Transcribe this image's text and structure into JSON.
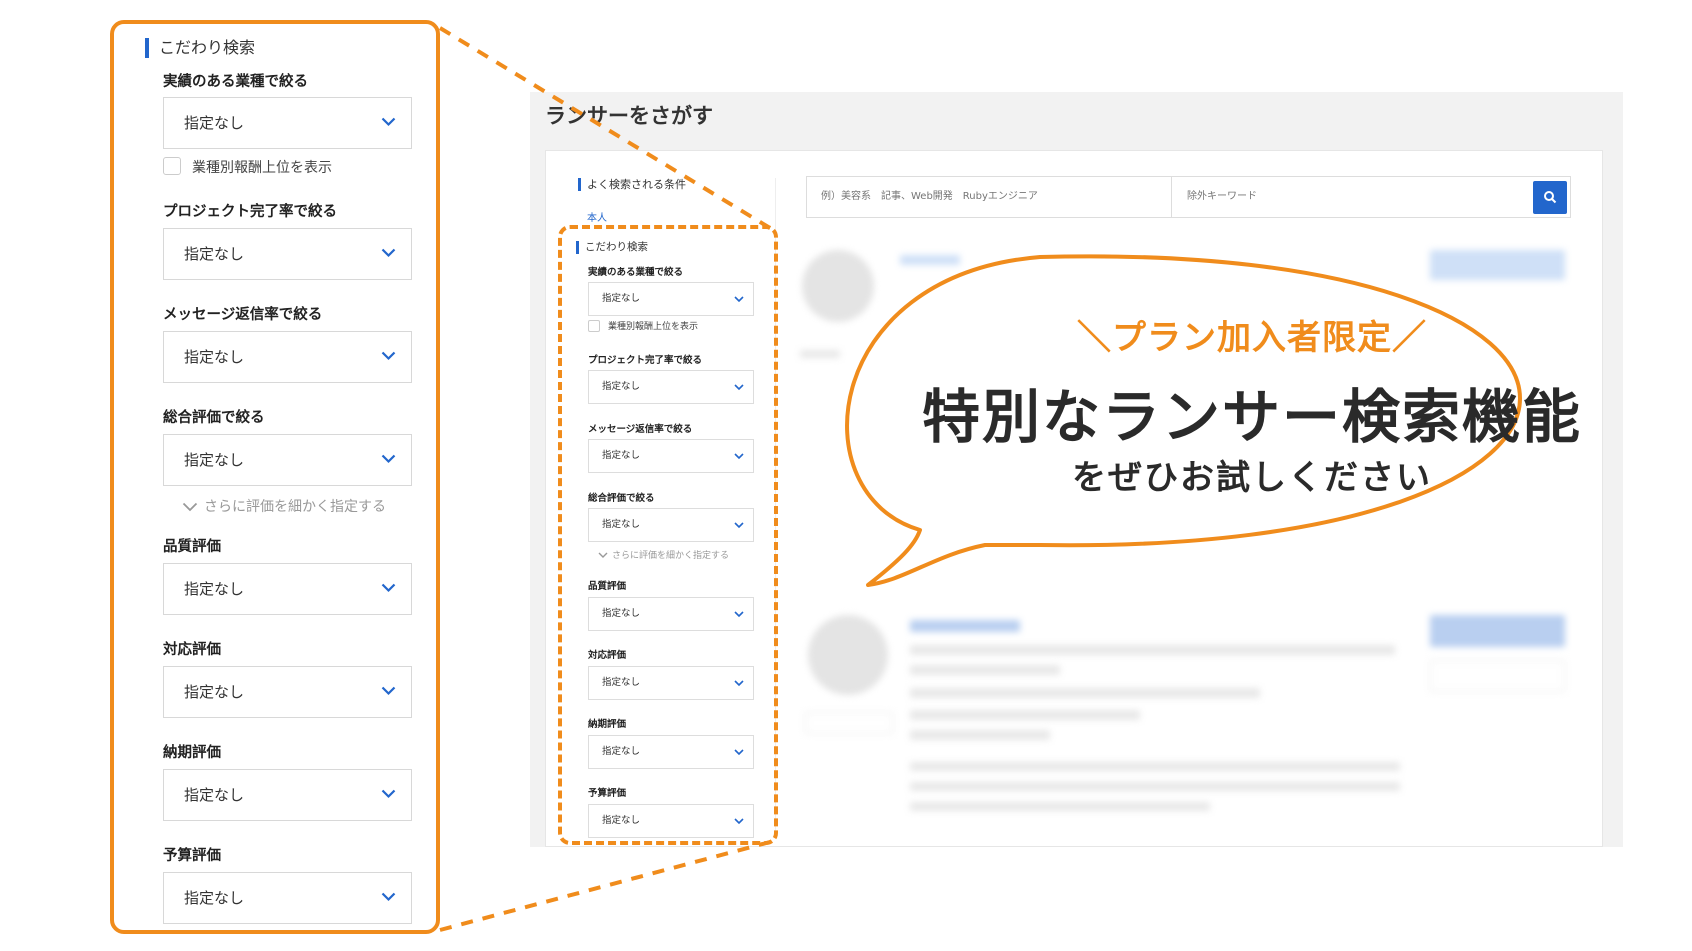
{
  "colors": {
    "accent": "#f08c1c",
    "brand_blue": "#2266cc",
    "text": "#2a2a2a"
  },
  "background_page": {
    "title": "ランサーをさがす",
    "sidebar_heading": "よく検索される条件",
    "sidebar_link": "本人",
    "search": {
      "keyword_placeholder": "例）美容系　記事、Web開発　Rubyエンジニア",
      "exclude_placeholder": "除外キーワード",
      "button_icon": "search-icon"
    }
  },
  "filters": {
    "heading": "こだわり検索",
    "default_option": "指定なし",
    "industry_label": "実績のある業種で絞る",
    "industry_value": "指定なし",
    "top_reward_checkbox": "業種別報酬上位を表示",
    "completion_label": "プロジェクト完了率で絞る",
    "completion_value": "指定なし",
    "reply_label": "メッセージ返信率で絞る",
    "reply_value": "指定なし",
    "overall_label": "総合評価で絞る",
    "overall_value": "指定なし",
    "more_ratings": "さらに評価を細かく指定する",
    "quality_label": "品質評価",
    "quality_value": "指定なし",
    "response_label": "対応評価",
    "response_value": "指定なし",
    "deadline_label": "納期評価",
    "deadline_value": "指定なし",
    "budget_label": "予算評価",
    "budget_value": "指定なし"
  },
  "promo": {
    "subtitle": "＼プラン加入者限定／",
    "headline": "特別なランサー検索機能",
    "note": "をぜひお試しください"
  }
}
